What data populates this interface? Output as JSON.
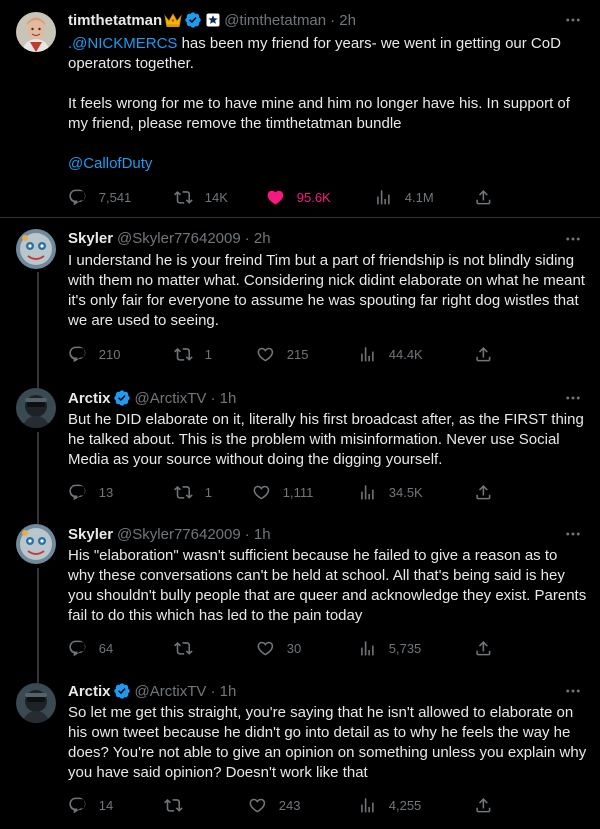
{
  "tweets": [
    {
      "name": "timthetatman",
      "handle": "@timthetatman",
      "time": "· 2h",
      "paragraphs": [
        {
          "mention": ".@NICKMERCS",
          "text": " has been my friend for years- we went in getting our CoD operators together."
        },
        {
          "text": "It feels wrong for me to have mine and him no longer have his. In support of my friend, please remove the timthetatman bundle"
        },
        {
          "mention": "@CallofDuty",
          "text": ""
        }
      ],
      "replies": "7,541",
      "retweets": "14K",
      "likes": "95.6K",
      "views": "4.1M"
    },
    {
      "name": "Skyler",
      "handle": "@Skyler77642009",
      "time": "· 2h",
      "text": "I understand he is your freind Tim but a part of friendship is not blindly siding with them no matter what. Considering nick didint elaborate on what he meant it's only fair for everyone to assume he was spouting far right dog wistles that we are used to seeing.",
      "replies": "210",
      "retweets": "1",
      "likes": "215",
      "views": "44.4K"
    },
    {
      "name": "Arctix",
      "handle": "@ArctixTV",
      "time": "· 1h",
      "text": "But he DID elaborate on it, literally his first broadcast after, as the FIRST thing he talked about. This is the problem with misinformation. Never use Social Media as your source without doing the digging yourself.",
      "replies": "13",
      "retweets": "1",
      "likes": "1,111",
      "views": "34.5K"
    },
    {
      "name": "Skyler",
      "handle": "@Skyler77642009",
      "time": "· 1h",
      "text": "His \"elaboration\" wasn't sufficient because he failed to give a reason as to why these conversations can't be held at school. All that's being said is hey you shouldn't bully people that are queer and acknowledge they exist. Parents fail to do this which has led to the pain today",
      "replies": "64",
      "retweets": "",
      "likes": "30",
      "views": "5,735"
    },
    {
      "name": "Arctix",
      "handle": "@ArctixTV",
      "time": "· 1h",
      "text": "So let me get this straight, you're saying that he isn't allowed to elaborate on his own tweet because he didn't go into detail as to why he feels the way he does? You're not able to give an opinion on something unless you explain why you have said opinion? Doesn't work like that",
      "replies": "14",
      "retweets": "",
      "likes": "243",
      "views": "4,255"
    }
  ],
  "icons": {
    "more": "more-horizontal-icon",
    "reply": "reply-icon",
    "retweet": "retweet-icon",
    "like": "heart-icon",
    "views": "views-bar-chart-icon",
    "share": "share-icon",
    "verified": "verified-badge-icon",
    "crown": "crown-emoji-icon",
    "star": "star-icon"
  },
  "colors": {
    "background": "#000000",
    "text": "#e7e9ea",
    "secondary": "#71767b",
    "link": "#1d9bf0",
    "like": "#f91880",
    "verified": "#1d9bf0"
  }
}
